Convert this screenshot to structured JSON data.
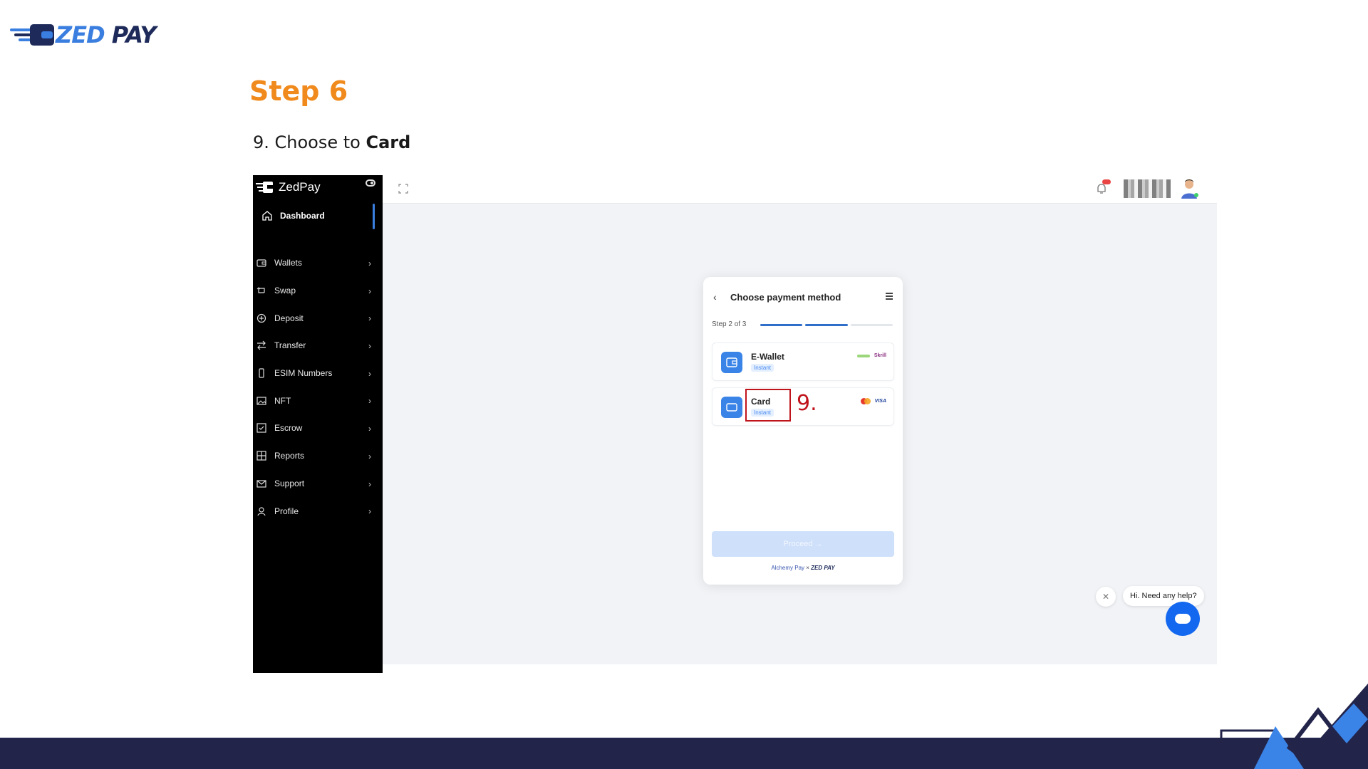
{
  "brand": {
    "zed": "ZED",
    "pay": "PAY"
  },
  "step": {
    "title": "Step 6",
    "instruction_prefix": "9. Choose to ",
    "instruction_bold": "Card"
  },
  "sidebar": {
    "brand": "ZedPay",
    "active_item": "Dashboard",
    "items": [
      {
        "label": "Wallets",
        "icon": "wallet-icon"
      },
      {
        "label": "Swap",
        "icon": "swap-icon"
      },
      {
        "label": "Deposit",
        "icon": "plus-circle-icon"
      },
      {
        "label": "Transfer",
        "icon": "transfer-icon"
      },
      {
        "label": "ESIM Numbers",
        "icon": "phone-icon"
      },
      {
        "label": "NFT",
        "icon": "image-icon"
      },
      {
        "label": "Escrow",
        "icon": "check-square-icon"
      },
      {
        "label": "Reports",
        "icon": "grid-icon"
      },
      {
        "label": "Support",
        "icon": "mail-icon"
      },
      {
        "label": "Profile",
        "icon": "user-icon"
      }
    ]
  },
  "modal": {
    "title": "Choose payment method",
    "step_text": "Step 2 of 3",
    "progress_steps_done": 2,
    "progress_steps_total": 3,
    "options": [
      {
        "name": "E-Wallet",
        "badge": "Instant",
        "logos": [
          "neteller",
          "Skrill"
        ]
      },
      {
        "name": "Card",
        "badge": "Instant",
        "logos": [
          "mastercard",
          "VISA"
        ]
      }
    ],
    "annotation_number": "9.",
    "proceed_label": "Proceed →",
    "powered_by_left": "Alchemy Pay",
    "powered_by_sep": "×",
    "powered_by_right": "ZED PAY"
  },
  "chat": {
    "close": "✕",
    "prompt": "Hi. Need any help?"
  },
  "colors": {
    "accent_orange": "#f08a1c",
    "accent_blue": "#3a84e8",
    "highlight_red": "#c0141c",
    "band_navy": "#23244a"
  }
}
